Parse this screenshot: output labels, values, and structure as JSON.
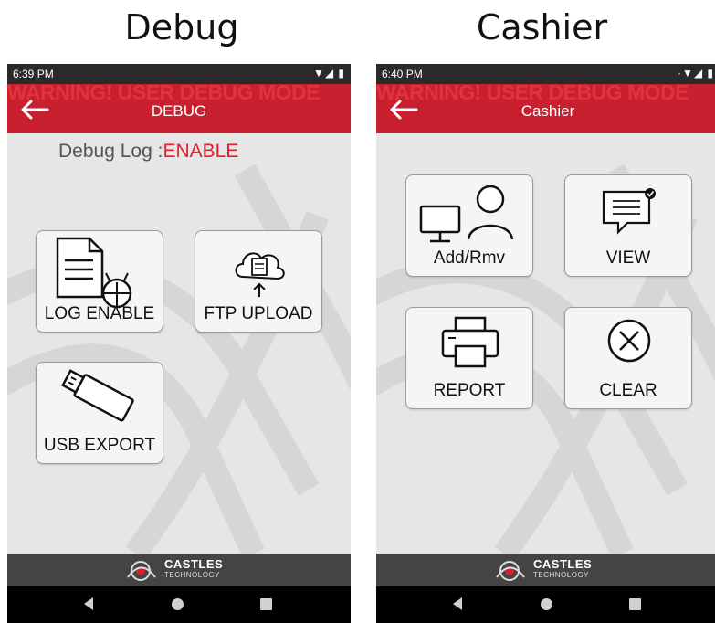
{
  "captions": {
    "left": "Debug",
    "right": "Cashier"
  },
  "debug_screen": {
    "status_time": "6:39 PM",
    "status_icons": "▼◢ ▮",
    "warning_banner": "WARNING! USER DEBUG MODE",
    "title": "DEBUG",
    "log_label": "Debug Log :",
    "log_value": "ENABLE",
    "buttons": {
      "log_enable": "LOG ENABLE",
      "ftp_upload": "FTP UPLOAD",
      "usb_export": "USB EXPORT"
    },
    "footer": {
      "brand": "CASTLES",
      "sub": "TECHNOLOGY"
    }
  },
  "cashier_screen": {
    "status_time": "6:40 PM",
    "status_icons": "·▼◢ ▮",
    "warning_banner": "WARNING! USER DEBUG MODE",
    "title": "Cashier",
    "buttons": {
      "add_rmv": "Add/Rmv",
      "view": "VIEW",
      "report": "REPORT",
      "clear": "CLEAR"
    },
    "footer": {
      "brand": "CASTLES",
      "sub": "TECHNOLOGY"
    }
  },
  "colors": {
    "accent_red": "#c8202e",
    "enable_red": "#e0202a",
    "footer": "#444444"
  }
}
